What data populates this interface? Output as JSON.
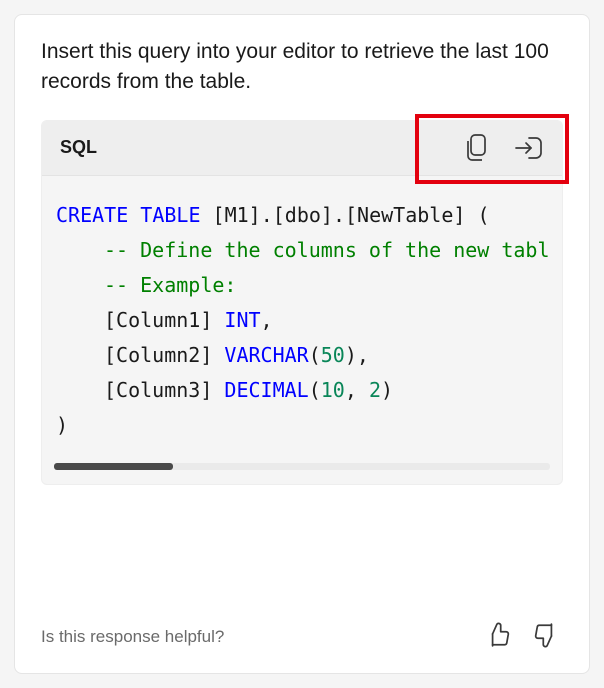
{
  "intro": "Insert this query into your editor to retrieve the last 100 records from the table.",
  "code": {
    "language": "SQL",
    "lines": {
      "l1_kw": "CREATE TABLE",
      "l1_rest": " [M1].[dbo].[NewTable] (",
      "l2_comment": "-- Define the columns of the new tabl",
      "l3_comment": "-- Example:",
      "l4_col": "[Column1] ",
      "l4_type": "INT",
      "l4_end": ",",
      "l5_col": "[Column2] ",
      "l5_type": "VARCHAR",
      "l5_paren_o": "(",
      "l5_num": "50",
      "l5_paren_c": "),",
      "l6_col": "[Column3] ",
      "l6_type": "DECIMAL",
      "l6_paren_o": "(",
      "l6_num1": "10",
      "l6_comma": ", ",
      "l6_num2": "2",
      "l6_paren_c": ")",
      "l7": ")"
    }
  },
  "footer": {
    "prompt": "Is this response helpful?"
  },
  "icons": {
    "copy": "copy-icon",
    "insert": "insert-icon",
    "thumbs_up": "thumbs-up-icon",
    "thumbs_down": "thumbs-down-icon"
  }
}
